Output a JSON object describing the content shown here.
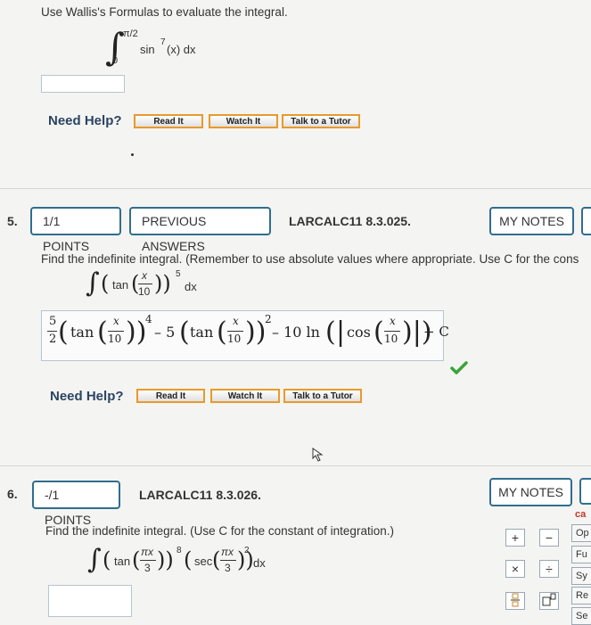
{
  "q4": {
    "prompt": "Use Wallis's Formulas to evaluate the integral.",
    "integral": {
      "upper": "π/2",
      "lower": "0",
      "integrand": "sin",
      "power": "7",
      "arg": "(x) dx"
    },
    "need_help": "Need Help?",
    "help_buttons": [
      "Read It",
      "Watch It",
      "Talk to a Tutor"
    ]
  },
  "q5": {
    "number": "5.",
    "points": "1/1 POINTS",
    "previous_answers": "PREVIOUS ANSWERS",
    "code": "LARCALC11 8.3.025.",
    "my_notes": "MY NOTES",
    "prompt": "Find the indefinite integral. (Remember to use absolute values where appropriate. Use C for the cons",
    "integral": {
      "tan": "tan",
      "num": "x",
      "den": "10",
      "power": "5",
      "dx": "dx"
    },
    "answer": {
      "coef1_num": "5",
      "coef1_den": "2",
      "tan1": "tan",
      "x1": "x",
      "d1": "10",
      "p1": "4",
      "minus1": "– 5",
      "tan2": "tan",
      "x2": "x",
      "d2": "10",
      "p2": "2",
      "minus2": "– 10 ln",
      "cos": "cos",
      "x3": "x",
      "d3": "10",
      "plus_c": "+ C"
    },
    "need_help": "Need Help?",
    "help_buttons": [
      "Read It",
      "Watch It",
      "Talk to a Tutor"
    ]
  },
  "q6": {
    "number": "6.",
    "points": "-/1 POINTS",
    "code": "LARCALC11 8.3.026.",
    "my_notes": "MY NOTES",
    "prompt": "Find the indefinite integral. (Use C for the constant of integration.)",
    "integral": {
      "tan": "tan",
      "num1": "πx",
      "den1": "3",
      "p1": "8",
      "sec": "sec",
      "num2": "πx",
      "den2": "3",
      "p2": "2",
      "dx": "dx"
    },
    "calc_buttons": [
      "+",
      "−",
      "×",
      "÷"
    ],
    "side_tabs": [
      "ca",
      "Op",
      "Fu",
      "Sy",
      "Re",
      "Se"
    ]
  },
  "colors": {
    "accent_border": "#2f6e8e",
    "help_border": "#e89a2a",
    "check_green": "#3aa43a",
    "need_help_text": "#2b4463"
  }
}
